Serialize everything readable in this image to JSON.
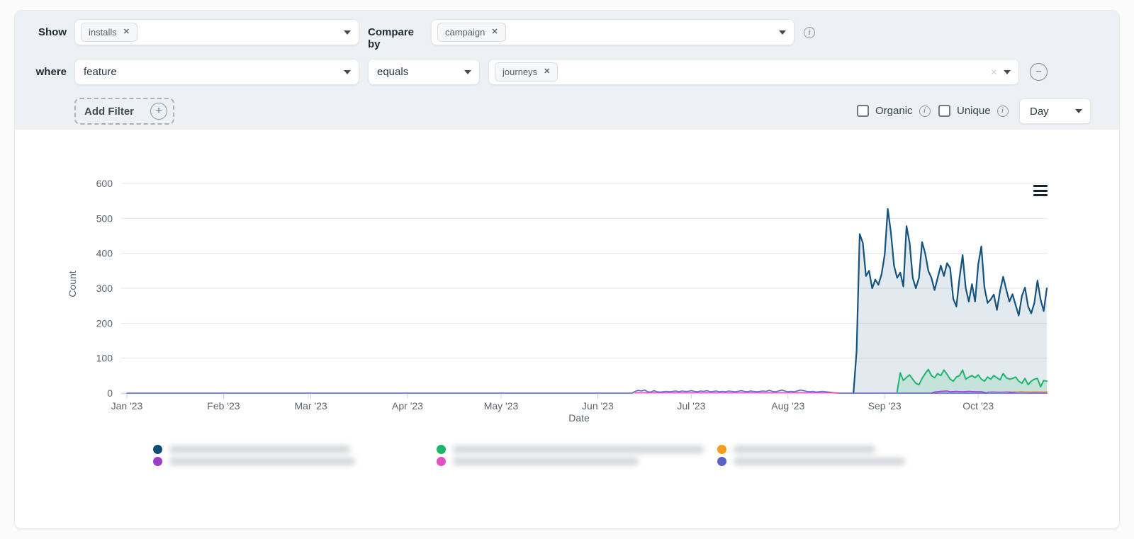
{
  "filters": {
    "show": {
      "label": "Show",
      "chips": [
        "installs"
      ]
    },
    "compare_by": {
      "label": "Compare by",
      "chips": [
        "campaign"
      ]
    },
    "where": {
      "label": "where",
      "field": "feature",
      "operator": "equals",
      "chips": [
        "journeys"
      ]
    },
    "add_filter_label": "Add Filter",
    "organic_label": "Organic",
    "unique_label": "Unique",
    "granularity_value": "Day"
  },
  "icons": {
    "close": "✕",
    "info": "i",
    "minus": "−",
    "plus": "+"
  },
  "chart_data": {
    "type": "area",
    "title": "",
    "xlabel": "Date",
    "ylabel": "Count",
    "ylim": [
      0,
      600
    ],
    "yticks": [
      0,
      100,
      200,
      300,
      400,
      500,
      600
    ],
    "grid": true,
    "x_unit": "days since 2023-01-01",
    "xticks": [
      {
        "label": "Jan '23",
        "day": 0
      },
      {
        "label": "Feb '23",
        "day": 31
      },
      {
        "label": "Mar '23",
        "day": 59
      },
      {
        "label": "Apr '23",
        "day": 90
      },
      {
        "label": "May '23",
        "day": 120
      },
      {
        "label": "Jun '23",
        "day": 151
      },
      {
        "label": "Jul '23",
        "day": 181
      },
      {
        "label": "Aug '23",
        "day": 212
      },
      {
        "label": "Sep '23",
        "day": 243
      },
      {
        "label": "Oct '23",
        "day": 273
      }
    ],
    "series": [
      {
        "name": "campaign-1 (label blurred)",
        "color": "#15537e",
        "fill": "rgba(21,83,126,0.12)",
        "width": 2.2,
        "segments": [
          [
            [
              233,
              0
            ],
            [
              234,
              120
            ],
            [
              235,
              455
            ],
            [
              236,
              430
            ],
            [
              237,
              335
            ],
            [
              238,
              350
            ],
            [
              239,
              300
            ],
            [
              240,
              325
            ],
            [
              241,
              310
            ],
            [
              242,
              340
            ],
            [
              243,
              395
            ],
            [
              244,
              527
            ],
            [
              245,
              460
            ],
            [
              246,
              365
            ],
            [
              247,
              330
            ],
            [
              248,
              345
            ],
            [
              249,
              305
            ],
            [
              250,
              478
            ],
            [
              251,
              430
            ],
            [
              252,
              330
            ],
            [
              253,
              300
            ],
            [
              254,
              330
            ],
            [
              255,
              432
            ],
            [
              256,
              400
            ],
            [
              257,
              350
            ],
            [
              258,
              330
            ],
            [
              259,
              295
            ],
            [
              260,
              330
            ],
            [
              261,
              365
            ],
            [
              262,
              335
            ],
            [
              263,
              372
            ],
            [
              264,
              358
            ],
            [
              265,
              270
            ],
            [
              266,
              248
            ],
            [
              267,
              330
            ],
            [
              268,
              395
            ],
            [
              269,
              300
            ],
            [
              270,
              262
            ],
            [
              271,
              312
            ],
            [
              272,
              262
            ],
            [
              273,
              368
            ],
            [
              274,
              420
            ],
            [
              275,
              302
            ],
            [
              276,
              258
            ],
            [
              277,
              268
            ],
            [
              278,
              282
            ],
            [
              279,
              238
            ],
            [
              280,
              292
            ],
            [
              281,
              333
            ],
            [
              282,
              296
            ],
            [
              283,
              262
            ],
            [
              284,
              283
            ],
            [
              285,
              252
            ],
            [
              286,
              222
            ],
            [
              287,
              278
            ],
            [
              288,
              302
            ],
            [
              289,
              248
            ],
            [
              290,
              228
            ],
            [
              291,
              258
            ],
            [
              292,
              322
            ],
            [
              293,
              268
            ],
            [
              294,
              235
            ],
            [
              295,
              300
            ]
          ]
        ]
      },
      {
        "name": "campaign-2 (label blurred)",
        "color": "#1db56b",
        "fill": "rgba(29,181,108,0.15)",
        "width": 2,
        "segments": [
          [
            [
              247,
              4
            ],
            [
              248,
              58
            ],
            [
              249,
              36
            ],
            [
              250,
              45
            ],
            [
              251,
              52
            ],
            [
              252,
              40
            ],
            [
              253,
              28
            ],
            [
              254,
              24
            ],
            [
              255,
              42
            ],
            [
              256,
              56
            ],
            [
              257,
              68
            ],
            [
              258,
              50
            ],
            [
              259,
              44
            ],
            [
              260,
              56
            ],
            [
              261,
              50
            ],
            [
              262,
              66
            ],
            [
              263,
              54
            ],
            [
              264,
              40
            ],
            [
              265,
              34
            ],
            [
              266,
              46
            ],
            [
              267,
              50
            ],
            [
              268,
              66
            ],
            [
              269,
              40
            ],
            [
              270,
              46
            ],
            [
              271,
              50
            ],
            [
              272,
              44
            ],
            [
              273,
              52
            ],
            [
              274,
              40
            ],
            [
              275,
              34
            ],
            [
              276,
              46
            ],
            [
              277,
              40
            ],
            [
              278,
              50
            ],
            [
              279,
              44
            ],
            [
              280,
              38
            ],
            [
              281,
              56
            ],
            [
              282,
              44
            ],
            [
              283,
              40
            ],
            [
              284,
              42
            ],
            [
              285,
              46
            ],
            [
              286,
              34
            ],
            [
              287,
              28
            ],
            [
              288,
              42
            ],
            [
              289,
              24
            ],
            [
              290,
              34
            ],
            [
              291,
              40
            ],
            [
              292,
              42
            ],
            [
              293,
              18
            ],
            [
              294,
              36
            ],
            [
              295,
              34
            ]
          ]
        ]
      },
      {
        "name": "campaign-3 (label blurred)",
        "color": "#5c68c8",
        "fill": "rgba(92,104,200,0.15)",
        "width": 1.6,
        "segments": [
          [
            [
              0,
              0
            ],
            [
              162,
              0
            ],
            [
              163,
              5
            ],
            [
              164,
              8
            ],
            [
              165,
              6
            ],
            [
              166,
              9
            ],
            [
              167,
              4
            ],
            [
              168,
              3
            ],
            [
              169,
              7
            ],
            [
              170,
              4
            ],
            [
              171,
              3
            ],
            [
              172,
              4
            ],
            [
              173,
              5
            ],
            [
              174,
              4
            ],
            [
              175,
              5
            ],
            [
              176,
              6
            ],
            [
              177,
              4
            ],
            [
              178,
              6
            ],
            [
              179,
              5
            ],
            [
              180,
              5
            ],
            [
              181,
              7
            ],
            [
              182,
              5
            ],
            [
              183,
              4
            ],
            [
              184,
              6
            ],
            [
              185,
              5
            ],
            [
              186,
              7
            ],
            [
              187,
              4
            ],
            [
              188,
              5
            ],
            [
              189,
              6
            ],
            [
              190,
              4
            ],
            [
              191,
              5
            ],
            [
              192,
              4
            ],
            [
              193,
              6
            ],
            [
              194,
              5
            ],
            [
              195,
              4
            ],
            [
              196,
              5
            ],
            [
              197,
              7
            ],
            [
              198,
              5
            ],
            [
              199,
              4
            ],
            [
              200,
              6
            ],
            [
              201,
              5
            ],
            [
              202,
              4
            ],
            [
              203,
              5
            ],
            [
              204,
              6
            ],
            [
              205,
              5
            ],
            [
              206,
              8
            ],
            [
              207,
              5
            ],
            [
              208,
              4
            ],
            [
              209,
              6
            ],
            [
              210,
              9
            ],
            [
              211,
              6
            ],
            [
              212,
              4
            ],
            [
              213,
              5
            ],
            [
              214,
              4
            ],
            [
              215,
              6
            ],
            [
              216,
              9
            ],
            [
              217,
              7
            ],
            [
              218,
              5
            ],
            [
              219,
              4
            ],
            [
              220,
              5
            ],
            [
              221,
              3
            ],
            [
              222,
              4
            ],
            [
              223,
              5
            ],
            [
              224,
              4
            ],
            [
              225,
              3
            ],
            [
              226,
              2
            ],
            [
              227,
              1
            ],
            [
              228,
              0
            ],
            [
              295,
              0
            ]
          ]
        ]
      },
      {
        "name": "campaign-4 (label blurred)",
        "color": "#8e3cc9",
        "fill": null,
        "width": 1.5,
        "segments": [
          [
            [
              258,
              0
            ],
            [
              259,
              3
            ],
            [
              261,
              5
            ],
            [
              263,
              6
            ],
            [
              264,
              4
            ],
            [
              266,
              5
            ],
            [
              268,
              4
            ],
            [
              270,
              5
            ],
            [
              272,
              4
            ],
            [
              274,
              4
            ],
            [
              276,
              0
            ]
          ],
          [
            [
              283,
              2
            ],
            [
              285,
              3
            ],
            [
              287,
              4
            ],
            [
              289,
              3
            ],
            [
              291,
              3
            ],
            [
              293,
              3
            ],
            [
              295,
              3
            ]
          ]
        ]
      },
      {
        "name": "campaign-5 (label blurred)",
        "color": "#e054c0",
        "fill": null,
        "width": 1.3,
        "segments": [
          [
            [
              163,
              1
            ],
            [
              228,
              1
            ]
          ],
          [
            [
              276,
              3
            ],
            [
              278,
              4
            ],
            [
              280,
              3
            ],
            [
              282,
              4
            ],
            [
              284,
              3
            ],
            [
              286,
              4
            ],
            [
              288,
              3
            ],
            [
              290,
              3
            ],
            [
              292,
              4
            ],
            [
              295,
              3
            ]
          ]
        ]
      },
      {
        "name": "campaign-6 (label blurred)",
        "color": "#f6a21e",
        "fill": null,
        "width": 1.5,
        "segments": [
          [
            [
              285,
              3
            ],
            [
              287,
              4
            ],
            [
              289,
              3
            ],
            [
              291,
              4
            ],
            [
              293,
              3
            ],
            [
              295,
              4
            ]
          ]
        ]
      }
    ],
    "legend": {
      "position": "bottom",
      "labels_blurred": true,
      "columns": [
        {
          "items": [
            {
              "color": "#114e75",
              "blur_width": 255
            },
            {
              "color": "#9b3fc9",
              "blur_width": 262
            }
          ]
        },
        {
          "items": [
            {
              "color": "#1db56b",
              "blur_width": 354
            },
            {
              "color": "#e052c4",
              "blur_width": 262
            }
          ]
        },
        {
          "items": [
            {
              "color": "#f79c1c",
              "blur_width": 200
            },
            {
              "color": "#5a62c8",
              "blur_width": 242
            }
          ]
        }
      ]
    }
  }
}
